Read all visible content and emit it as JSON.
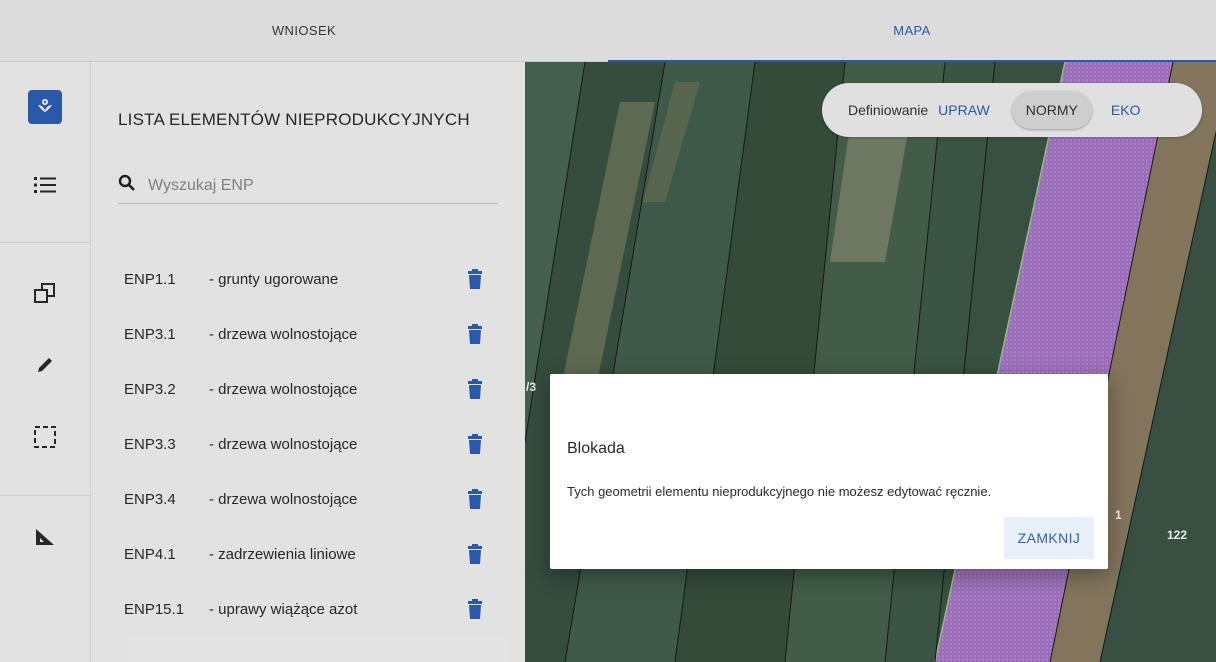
{
  "tabs": [
    {
      "label": "WNIOSEK",
      "active": false
    },
    {
      "label": "MAPA",
      "active": true
    }
  ],
  "rail": {
    "icons": [
      "flower-enp-icon",
      "list-icon",
      "copy-shapes-icon",
      "pencil-icon",
      "select-rectangle-icon",
      "ruler-triangle-icon"
    ]
  },
  "panel": {
    "title": "LISTA ELEMENTÓW NIEPRODUKCYJNYCH",
    "search_placeholder": "Wyszukaj ENP",
    "items": [
      {
        "code": "ENP1.1",
        "desc": "- grunty ugorowane"
      },
      {
        "code": "ENP3.1",
        "desc": "- drzewa wolnostojące"
      },
      {
        "code": "ENP3.2",
        "desc": "- drzewa wolnostojące"
      },
      {
        "code": "ENP3.3",
        "desc": "- drzewa wolnostojące"
      },
      {
        "code": "ENP3.4",
        "desc": "- drzewa wolnostojące"
      },
      {
        "code": "ENP4.1",
        "desc": "- zadrzewienia liniowe"
      },
      {
        "code": "ENP15.1",
        "desc": "- uprawy wiążące azot"
      }
    ]
  },
  "map": {
    "mode_label": "Definiowanie",
    "modes": [
      "UPRAW",
      "NORMY",
      "EKO"
    ],
    "selected_mode": "NORMY",
    "parcel_labels": [
      "/3",
      "1",
      "122"
    ]
  },
  "dialog": {
    "title": "Blokada",
    "message": "Tych geometrii elementu nieprodukcyjnego nie możesz edytować ręcznie.",
    "close_label": "ZAMKNIJ"
  },
  "colors": {
    "accent": "#2e5fb8",
    "field_highlight": "#a877c9",
    "field_dark": "#3b5445"
  }
}
